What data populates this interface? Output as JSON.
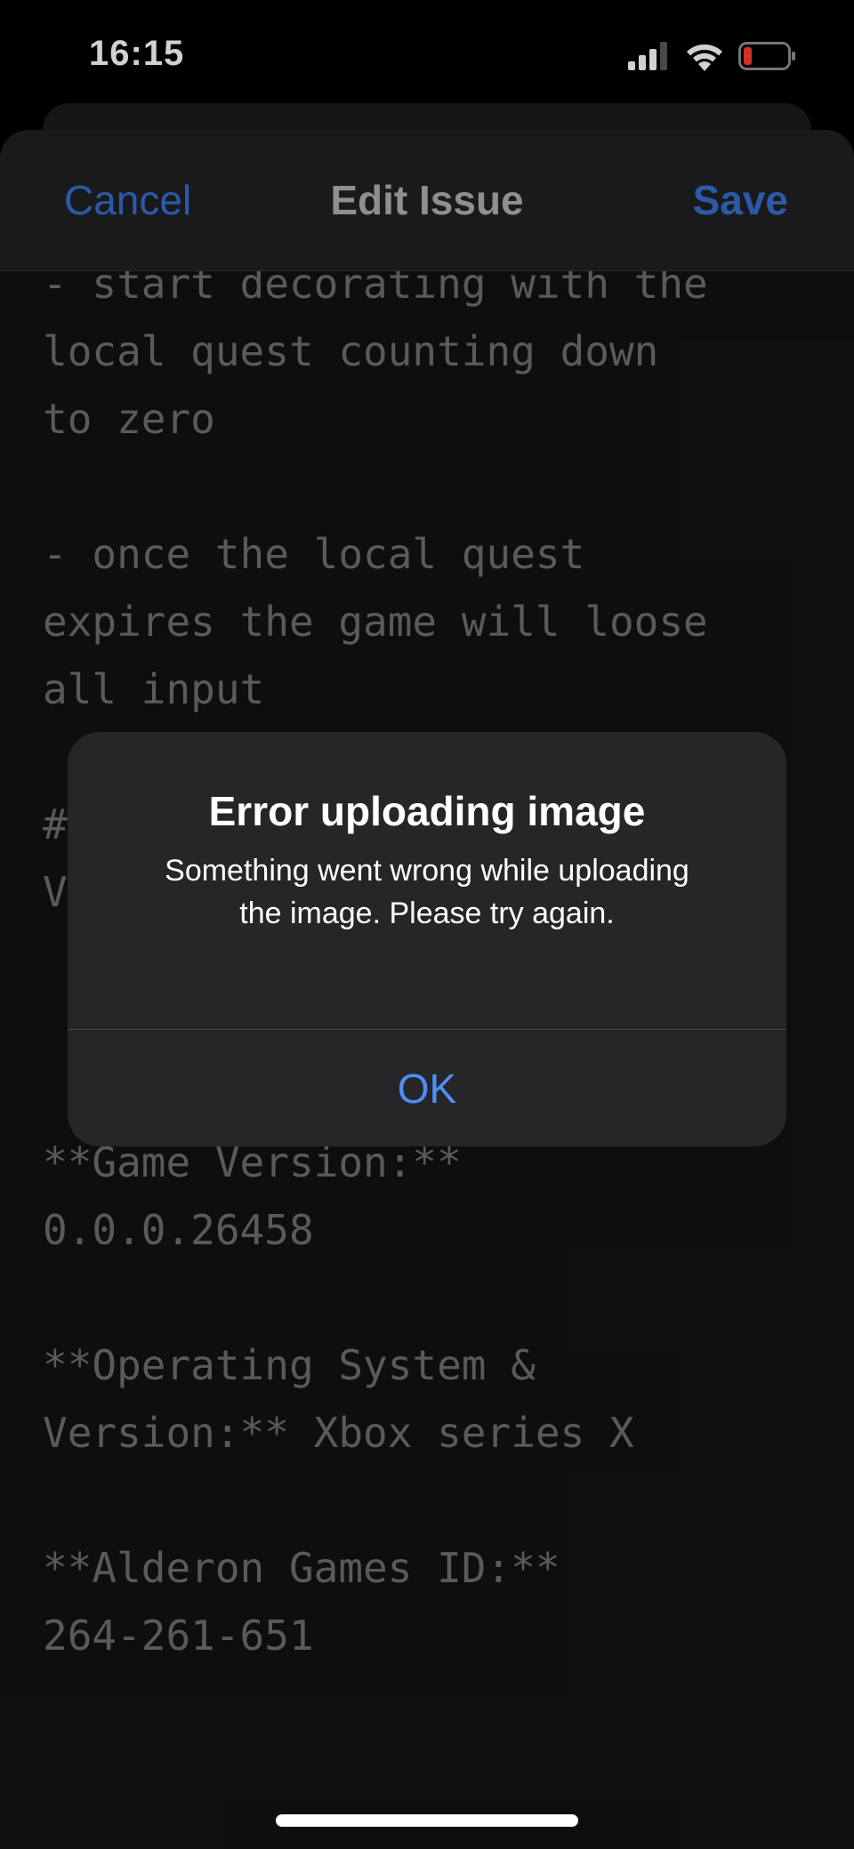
{
  "status_bar": {
    "time": "16:15",
    "icons": [
      "cellular-signal-icon",
      "wifi-icon",
      "battery-low-icon"
    ],
    "battery_color": "#ff3b30"
  },
  "nav": {
    "cancel_label": "Cancel",
    "title": "Edit Issue",
    "save_label": "Save",
    "accent_color": "#2c5aa8"
  },
  "editor": {
    "lines": [
      "- start decorating with the",
      "local quest counting down",
      "to zero",
      "",
      "- once the local quest",
      "expires the game will loose",
      "all input",
      "",
      "#",
      "V",
      "",
      "",
      "",
      "**Game Version:**",
      "0.0.0.26458",
      "",
      "**Operating System &",
      "Version:** Xbox series X",
      "",
      "**Alderon Games ID:**",
      "264-261-651"
    ]
  },
  "alert": {
    "title": "Error uploading image",
    "message": "Something went wrong while uploading the image. Please try again.",
    "ok_label": "OK",
    "ok_color": "#4f8ef7"
  }
}
